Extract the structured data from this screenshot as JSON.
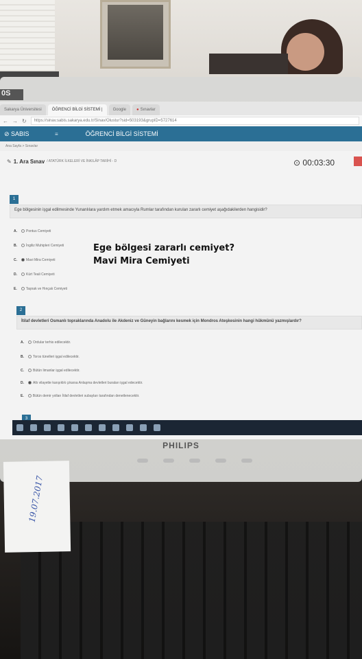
{
  "browser": {
    "tabs": [
      {
        "label": "Sakarya Üniversitesi",
        "active": false
      },
      {
        "label": "ÖĞRENCİ BİLGİ SİSTEMİ |",
        "active": true
      },
      {
        "label": "Google",
        "active": false
      },
      {
        "label": "Sınavlar",
        "active": false
      }
    ],
    "url": "https://sinav.sabis.sakarya.edu.tr/Sinav/Olustur?sid=503193&grupID=5727614"
  },
  "app": {
    "logo": "SABIS",
    "title": "ÖĞRENCİ BİLGİ SİSTEMİ",
    "breadcrumb": "Ana Sayfa > Sınavlar"
  },
  "exam": {
    "title": "1. Ara Sınav",
    "subtitle": "/ ATATÜRK İLKELERİ VE İNKILÂP TARİHİ - D",
    "timer": "00:03:30"
  },
  "questions": [
    {
      "number": "1",
      "text": "Ege bölgesinin işgal edilmesinde Yunanlılara yardım etmek amacıyla Rumlar tarafından kurulan zararlı cemiyet aşağıdakilerden hangisidir?",
      "options": [
        {
          "letter": "A.",
          "text": "Pontus Cemiyeti",
          "selected": false
        },
        {
          "letter": "B.",
          "text": "İngiliz Muhipleri Cemiyeti",
          "selected": false
        },
        {
          "letter": "C.",
          "text": "Mavi Mira Cemiyeti",
          "selected": true
        },
        {
          "letter": "D.",
          "text": "Kürt Teali Cemiyeti",
          "selected": false
        },
        {
          "letter": "E.",
          "text": "Taşnak ve Hınçak Cemiyeti",
          "selected": false
        }
      ]
    },
    {
      "number": "2",
      "text": "İtilaf devletleri Osmanlı topraklarında Anadolu ile Akdeniz ve Güneyin bağlarını kesmek için Mondros Ateşkesinin hangi hükmünü yazmışlardır?",
      "options": [
        {
          "letter": "A.",
          "text": "Ordular terhis edilecektir.",
          "selected": false
        },
        {
          "letter": "B.",
          "text": "Toros tünelleri işgal edilecektir.",
          "selected": false
        },
        {
          "letter": "C.",
          "text": "Bütün limanlar işgal edilecektir.",
          "selected": false
        },
        {
          "letter": "D.",
          "text": "Altı vilayette karışıklık çıkarsa Anlaşma devletleri buraları işgal edecektir.",
          "selected": true
        },
        {
          "letter": "E.",
          "text": "Bütün demir yolları İtilaf devletleri subayları tarafından denetlenecektir.",
          "selected": false
        }
      ]
    },
    {
      "number": "3"
    }
  ],
  "overlay": {
    "line1": "Ege bölgesi zararlı cemiyet?",
    "line2": "Mavi Mira Cemiyeti"
  },
  "monitor": {
    "brand": "PHILIPS",
    "os_badge": "0S"
  },
  "note": {
    "handwriting": "19.07.2017"
  }
}
